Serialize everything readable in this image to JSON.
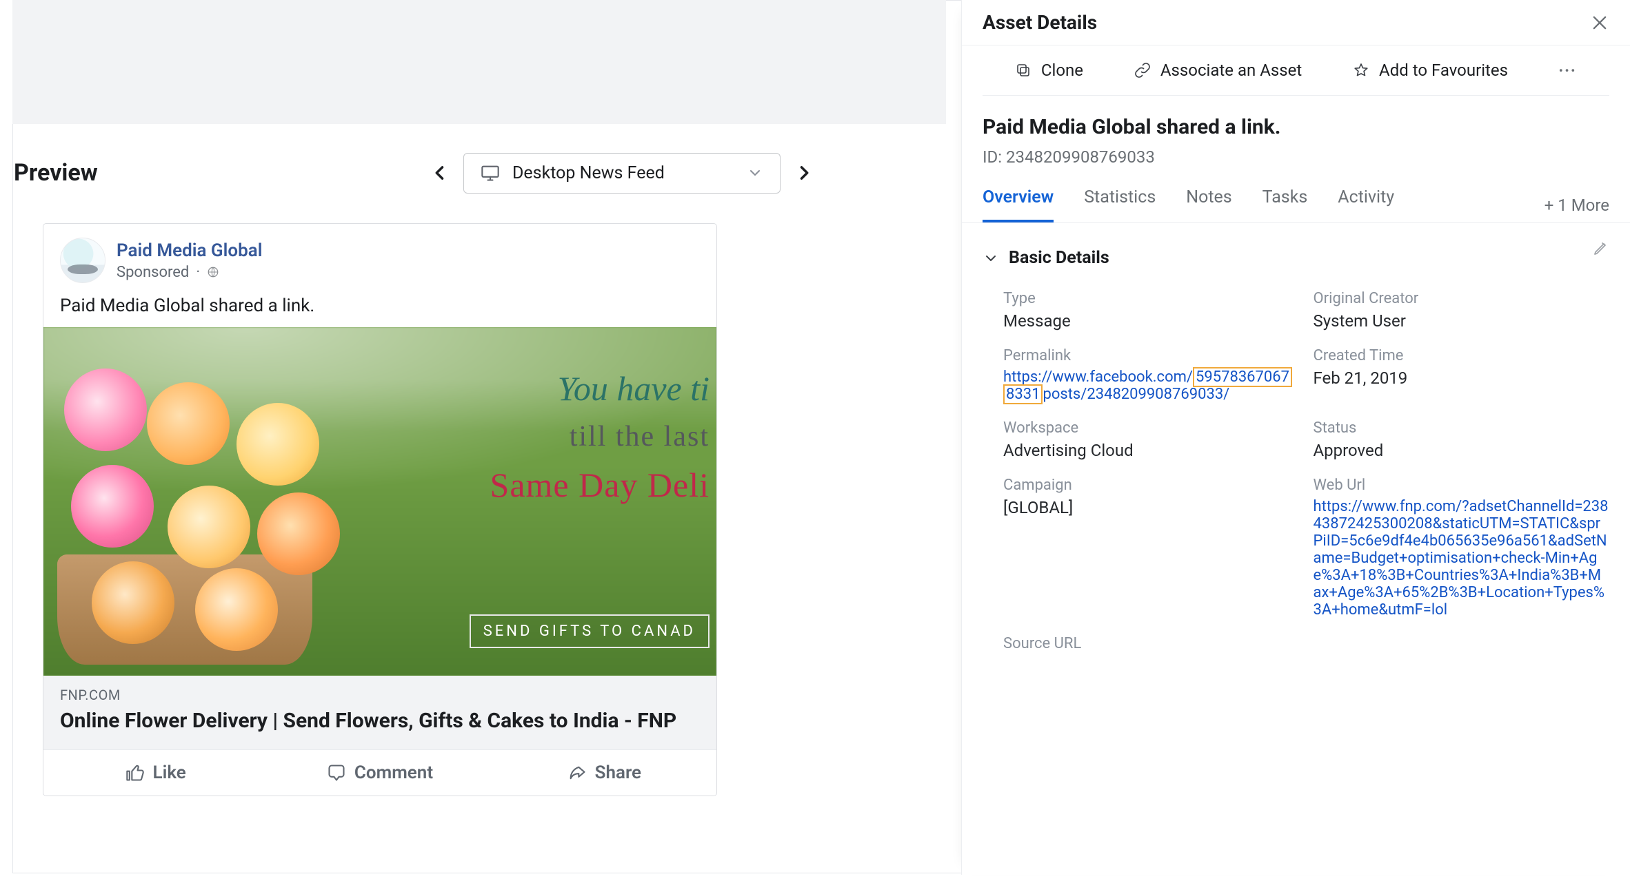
{
  "preview": {
    "title": "Preview",
    "feed_label": "Desktop News Feed"
  },
  "ad": {
    "page_name": "Paid Media Global",
    "sponsored": "Sponsored",
    "body": "Paid Media Global shared a link.",
    "image_overlay": {
      "line1": "You have ti",
      "line2": "till the last",
      "line3": "Same Day Deli",
      "cta": "SEND GIFTS TO CANAD"
    },
    "domain": "FNP.COM",
    "title": "Online Flower Delivery | Send Flowers, Gifts & Cakes to India - FNP",
    "actions": {
      "like": "Like",
      "comment": "Comment",
      "share": "Share"
    }
  },
  "panel": {
    "title": "Asset Details",
    "actions": {
      "clone": "Clone",
      "associate": "Associate an Asset",
      "favourite": "Add to Favourites"
    },
    "asset_name": "Paid Media Global shared a link.",
    "asset_id_label": "ID:",
    "asset_id": "2348209908769033",
    "tabs": {
      "overview": "Overview",
      "statistics": "Statistics",
      "notes": "Notes",
      "tasks": "Tasks",
      "activity": "Activity",
      "more": "+ 1 More"
    },
    "section_title": "Basic Details",
    "fields": {
      "type": {
        "label": "Type",
        "value": "Message"
      },
      "creator": {
        "label": "Original Creator",
        "value": "System User"
      },
      "permalink": {
        "label": "Permalink",
        "prefix": "https://www.facebook.com/",
        "highlight1": "59578367067",
        "highlight2": "8331",
        "suffix": "posts/2348209908769033/"
      },
      "created": {
        "label": "Created Time",
        "value": "Feb 21, 2019"
      },
      "workspace": {
        "label": "Workspace",
        "value": "Advertising Cloud"
      },
      "status": {
        "label": "Status",
        "value": "Approved"
      },
      "campaign": {
        "label": "Campaign",
        "value": "[GLOBAL]"
      },
      "weburl": {
        "label": "Web Url",
        "value": "https://www.fnp.com/?adsetChannelId=23843872425300208&staticUTM=STATIC&sprPiID=5c6e9df4e4b065635e96a561&adSetName=Budget+optimisation+check-Min+Age%3A+18%3B+Countries%3A+India%3B+Max+Age%3A+65%2B%3B+Location+Types%3A+home&utmF=lol"
      },
      "sourceurl": {
        "label": "Source URL"
      }
    }
  }
}
